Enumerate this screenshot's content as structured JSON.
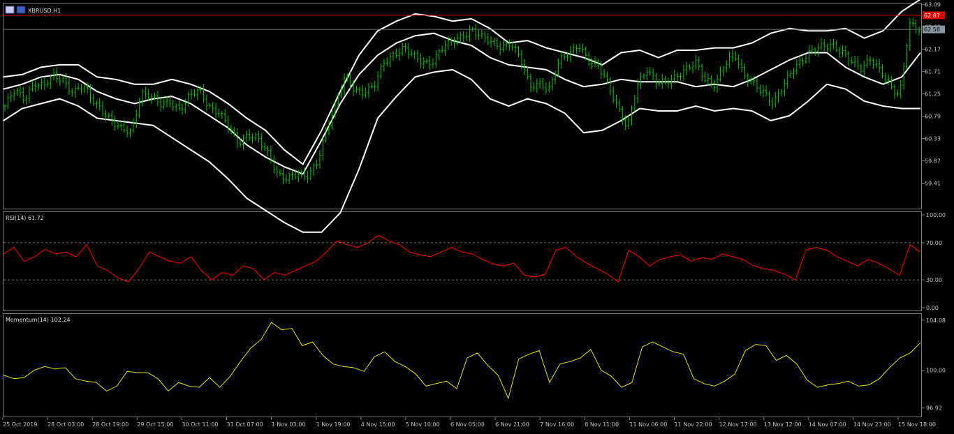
{
  "chart_data": [
    {
      "type": "candlestick",
      "title": "XBRUSD,H1",
      "symbol_icon": "flag-icon",
      "colors": {
        "background": "#000000",
        "candle": "#00c800",
        "bands": "#ffffff",
        "ask_line": "#c80000",
        "bid_line": "#6a7480",
        "axis": "#808080"
      },
      "y_ticks": [
        "63.09",
        "62.63",
        "62.17",
        "61.71",
        "61.25",
        "60.79",
        "60.33",
        "59.87",
        "59.41"
      ],
      "ylim": [
        58.9,
        63.1
      ],
      "ask_price": "62.87",
      "bid_price": "62.58",
      "close_path": [
        61.0,
        61.3,
        61.15,
        61.5,
        61.4,
        61.6,
        61.55,
        61.3,
        61.4,
        61.1,
        60.95,
        60.7,
        60.5,
        60.45,
        61.3,
        61.2,
        61.0,
        61.1,
        60.95,
        61.2,
        61.3,
        61.0,
        60.9,
        60.55,
        60.2,
        60.45,
        60.35,
        60.0,
        59.6,
        59.55,
        59.6,
        59.5,
        59.8,
        60.5,
        61.0,
        61.6,
        61.35,
        61.3,
        61.4,
        61.9,
        62.1,
        62.2,
        62.0,
        61.9,
        61.95,
        62.2,
        62.3,
        62.45,
        62.6,
        62.4,
        62.3,
        62.25,
        62.3,
        61.95,
        61.4,
        61.5,
        61.35,
        61.9,
        62.1,
        62.3,
        61.9,
        61.8,
        61.5,
        61.0,
        60.5,
        61.4,
        61.8,
        61.5,
        61.45,
        61.6,
        61.8,
        61.9,
        61.5,
        61.45,
        61.9,
        62.05,
        61.6,
        61.5,
        61.3,
        61.0,
        61.4,
        61.8,
        61.95,
        62.1,
        62.25,
        62.3,
        62.1,
        61.9,
        61.8,
        62.0,
        61.7,
        61.4,
        61.25,
        62.7,
        62.55
      ],
      "mid_band": [
        61.35,
        61.45,
        61.6,
        61.65,
        61.55,
        61.3,
        61.15,
        61.05,
        61.15,
        61.2,
        61.05,
        60.8,
        60.55,
        60.2,
        59.95,
        59.75,
        59.6,
        60.3,
        61.05,
        61.65,
        62.05,
        62.3,
        62.45,
        62.5,
        62.35,
        62.25,
        62.0,
        61.85,
        61.8,
        61.75,
        61.55,
        61.4,
        61.45,
        61.55,
        61.5,
        61.5,
        61.5,
        61.4,
        61.45,
        61.4,
        61.55,
        61.75,
        61.95,
        62.1,
        62.1,
        61.8,
        61.6,
        61.45,
        61.6,
        62.1
      ],
      "upper_band": [
        61.6,
        61.65,
        61.8,
        61.85,
        61.85,
        61.6,
        61.55,
        61.45,
        61.45,
        61.55,
        61.45,
        61.3,
        61.05,
        60.75,
        60.5,
        60.1,
        59.8,
        60.5,
        61.3,
        62.05,
        62.55,
        62.75,
        62.9,
        62.85,
        62.75,
        62.8,
        62.6,
        62.3,
        62.35,
        62.2,
        62.1,
        62.0,
        61.85,
        62.1,
        62.15,
        62.0,
        62.15,
        62.15,
        62.2,
        62.2,
        62.3,
        62.5,
        62.6,
        62.55,
        62.55,
        62.6,
        62.4,
        62.55,
        62.95,
        63.2
      ],
      "lower_band": [
        60.7,
        60.95,
        61.05,
        61.15,
        61.0,
        60.75,
        60.7,
        60.65,
        60.6,
        60.35,
        60.1,
        59.85,
        59.5,
        59.1,
        58.85,
        58.6,
        58.4,
        58.4,
        58.8,
        59.7,
        60.75,
        61.2,
        61.6,
        61.7,
        61.75,
        61.55,
        61.15,
        61.0,
        61.15,
        61.05,
        60.85,
        60.45,
        60.5,
        60.7,
        60.95,
        60.9,
        60.9,
        61.0,
        60.9,
        60.95,
        60.9,
        60.7,
        60.8,
        61.1,
        61.45,
        61.35,
        61.1,
        61.0,
        60.95,
        60.95
      ]
    },
    {
      "type": "line",
      "title": "RSI(14) 61.72",
      "y_ticks": [
        "100.00",
        "70.00",
        "30.00",
        "0.00"
      ],
      "ylim": [
        0,
        100
      ],
      "levels": [
        70,
        30
      ],
      "color": "#e00000",
      "values": [
        58,
        65,
        50,
        55,
        63,
        58,
        60,
        55,
        68,
        45,
        40,
        32,
        28,
        42,
        60,
        55,
        50,
        48,
        55,
        40,
        30,
        38,
        35,
        45,
        42,
        30,
        38,
        35,
        40,
        45,
        50,
        60,
        72,
        68,
        65,
        70,
        78,
        72,
        68,
        60,
        57,
        55,
        60,
        65,
        60,
        58,
        52,
        47,
        45,
        48,
        35,
        33,
        36,
        62,
        65,
        55,
        48,
        42,
        36,
        28,
        62,
        55,
        45,
        52,
        55,
        57,
        50,
        54,
        52,
        58,
        55,
        52,
        45,
        42,
        40,
        36,
        30,
        62,
        65,
        62,
        55,
        50,
        45,
        52,
        48,
        42,
        35,
        68,
        60
      ]
    },
    {
      "type": "line",
      "title": "Momentum(14) 102.24",
      "y_ticks": [
        "104.08",
        "100.00",
        "96.92"
      ],
      "ylim": [
        96.5,
        104.3
      ],
      "color": "#e6e600",
      "values": [
        99.6,
        99.3,
        99.4,
        100.0,
        100.3,
        100.1,
        100.2,
        99.3,
        99.1,
        99.0,
        98.3,
        98.7,
        99.9,
        99.8,
        99.8,
        99.3,
        98.3,
        99.0,
        98.7,
        98.6,
        99.4,
        98.6,
        99.5,
        100.7,
        101.8,
        102.5,
        103.9,
        103.3,
        103.4,
        102.0,
        102.3,
        101.2,
        100.5,
        100.3,
        100.2,
        99.9,
        101.1,
        101.5,
        100.7,
        100.3,
        99.7,
        98.7,
        98.9,
        99.1,
        98.5,
        101.0,
        101.4,
        100.4,
        99.6,
        97.7,
        100.9,
        101.3,
        101.6,
        99.0,
        100.5,
        100.7,
        101.0,
        101.7,
        100.0,
        99.5,
        98.6,
        99.0,
        101.9,
        102.3,
        101.9,
        101.5,
        101.3,
        99.3,
        98.9,
        98.7,
        99.1,
        99.7,
        101.6,
        102.1,
        102.0,
        100.8,
        101.2,
        100.5,
        99.2,
        98.6,
        98.8,
        98.9,
        99.1,
        98.7,
        98.8,
        99.3,
        100.2,
        101.0,
        101.4,
        102.24
      ]
    }
  ],
  "time_axis": {
    "labels": [
      "25 Oct 2019",
      "28 Oct 03:00",
      "28 Oct 19:00",
      "29 Oct 15:00",
      "30 Oct 11:00",
      "31 Oct 07:00",
      "1 Nov 03:00",
      "1 Nov 19:00",
      "4 Nov 15:00",
      "5 Nov 10:00",
      "6 Nov 05:00",
      "6 Nov 21:00",
      "7 Nov 16:00",
      "8 Nov 11:00",
      "11 Nov 06:00",
      "11 Nov 22:00",
      "12 Nov 17:00",
      "13 Nov 12:00",
      "14 Nov 07:00",
      "14 Nov 23:00",
      "15 Nov 18:00"
    ]
  }
}
